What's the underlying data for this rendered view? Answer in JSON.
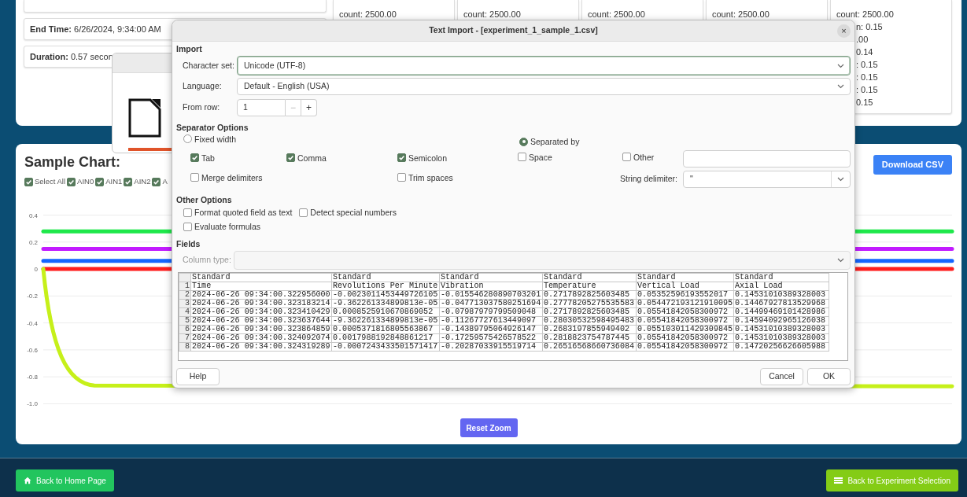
{
  "summary_card": {
    "info": [
      {
        "label": "End Time:",
        "value": "6/26/2024, 9:34:00 AM"
      },
      {
        "label": "Duration:",
        "value": "0.57 secon"
      }
    ],
    "statistics": [
      {
        "lines": [
          "count: 2500.00"
        ]
      },
      {
        "lines": [
          "count: 2500.00"
        ]
      },
      {
        "lines": [
          "count: 2500.00"
        ]
      },
      {
        "lines": [
          "count: 2500.00"
        ]
      },
      {
        "lines": [
          "count: 2500.00"
        ],
        "partial_lines": [
          "n: 0.15",
          ".00",
          "0.14",
          ": 0.15",
          ": 0.15",
          ": 0.15",
          "0.15"
        ]
      }
    ]
  },
  "sample_chart": {
    "title": "Sample Chart:",
    "download_label": "Download CSV",
    "filters": [
      {
        "label": "Select All",
        "checked": true
      },
      {
        "label": "AIN0",
        "checked": true
      },
      {
        "label": "AIN1",
        "checked": true
      },
      {
        "label": "AIN2",
        "checked": true
      },
      {
        "label": "A",
        "checked": true
      }
    ],
    "y_axis_labels": [
      "0.4",
      "0.2",
      "0",
      "-0.2",
      "-0.4",
      "-0.6",
      "-0.8",
      "-1.0"
    ],
    "reset_label": "Reset Zoom"
  },
  "dialog": {
    "title": "Text Import - [experiment_1_sample_1.csv]",
    "close": "×",
    "import": {
      "heading": "Import",
      "character_set": {
        "label": "Character set:",
        "value": "Unicode (UTF-8)"
      },
      "language": {
        "label": "Language:",
        "value": "Default - English (USA)"
      },
      "from_row": {
        "label": "From row:",
        "value": "1",
        "minus": {
          "symbol": "−",
          "disabled": true
        },
        "plus": {
          "symbol": "+",
          "disabled": false
        }
      }
    },
    "separator_options": {
      "heading": "Separator Options",
      "modes": [
        {
          "label": "Fixed width",
          "selected": false
        },
        {
          "label": "Separated by",
          "selected": true
        }
      ],
      "separators": [
        {
          "label": "Tab",
          "checked": true
        },
        {
          "label": "Comma",
          "checked": true
        },
        {
          "label": "Semicolon",
          "checked": true
        },
        {
          "label": "Space",
          "checked": false
        },
        {
          "label": "Other",
          "checked": false
        }
      ],
      "merge_delimiters": {
        "label": "Merge delimiters",
        "checked": false
      },
      "trim_spaces": {
        "label": "Trim spaces",
        "checked": false
      },
      "string_delimiter": {
        "label": "String delimiter:",
        "value": "\""
      }
    },
    "other_options": {
      "heading": "Other Options",
      "options": [
        {
          "label": "Format quoted field as text",
          "checked": false
        },
        {
          "label": "Detect special numbers",
          "checked": false
        },
        {
          "label": "Evaluate formulas",
          "checked": false
        }
      ]
    },
    "fields": {
      "heading": "Fields",
      "column_type": {
        "label": "Column type:",
        "disabled": true
      },
      "preview": {
        "column_types": [
          "Standard",
          "Standard",
          "Standard",
          "Standard",
          "Standard",
          "Standard"
        ],
        "rows": [
          {
            "number": "1",
            "cells": [
              "Time",
              "Revolutions Per Minute",
              "Vibration",
              "Temperature",
              "Vertical Load",
              "Axial Load"
            ]
          },
          {
            "number": "2",
            "cells": [
              "2024-06-26 09:34:00.322956000",
              "-0.0023011453449726105",
              "-0.015546280890703201",
              "0.2717892825603485",
              "0.05352596193552017",
              "0.14531010389328003"
            ]
          },
          {
            "number": "3",
            "cells": [
              "2024-06-26 09:34:00.323183214",
              "-9.362261334899813e-05",
              "-0.047713037580251694",
              "0.27778205275535583",
              "0.054472193121910095",
              "0.14467927813529968"
            ]
          },
          {
            "number": "4",
            "cells": [
              "2024-06-26 09:34:00.323410429",
              "0.0008525910670869052",
              "-0.07987979799509048",
              "0.2717892825603485",
              "0.05541842058300972",
              "0.14499469101428986"
            ]
          },
          {
            "number": "5",
            "cells": [
              "2024-06-26 09:34:00.323637644",
              "-9.362261334899813e-05",
              "-0.11267727613449097",
              "0.28030532598495483",
              "0.05541842058300972",
              "0.14594092965126038"
            ]
          },
          {
            "number": "6",
            "cells": [
              "2024-06-26 09:34:00.323864859",
              "0.0005371816805563867",
              "-0.14389795064926147",
              "0.2683197855949402",
              "0.055103011429309845",
              "0.14531010389328003"
            ]
          },
          {
            "number": "7",
            "cells": [
              "2024-06-26 09:34:00.324092074",
              "0.0017988192848861217",
              "-0.17259575426578522",
              "0.2818823754787445",
              "0.05541842058300972",
              "0.14531010389328003"
            ]
          },
          {
            "number": "8",
            "cells": [
              "2024-06-26 09:34:00.324319289",
              "-0.0007243433501571417",
              "-0.20287033915519714",
              "0.26516568660736084",
              "0.05541842058300972",
              "0.14720256626605988"
            ]
          }
        ]
      }
    },
    "buttons": {
      "help": "Help",
      "cancel": "Cancel",
      "ok": "OK"
    }
  },
  "footer": {
    "back_home": "Back to Home Page",
    "back_experiments": "Back to Experiment Selection"
  }
}
